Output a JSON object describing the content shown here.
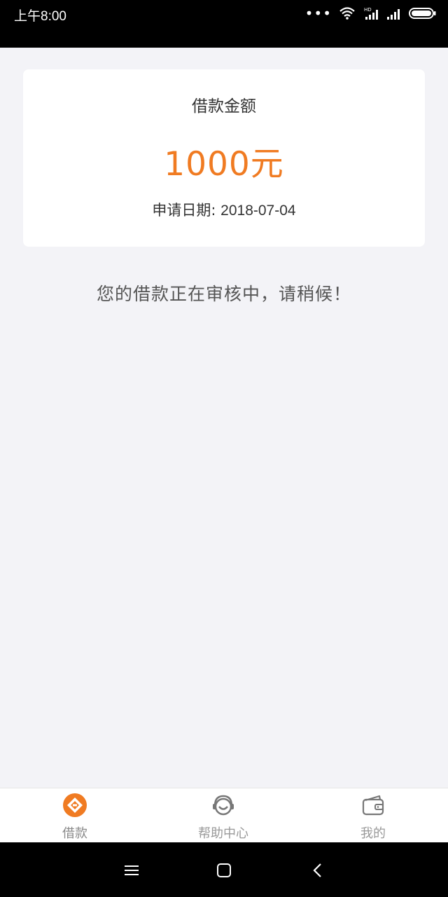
{
  "status_bar": {
    "time": "上午8:00",
    "icons": [
      "more-dots-icon",
      "wifi-icon",
      "hd-signal-icon",
      "signal-icon",
      "battery-icon"
    ]
  },
  "loan_card": {
    "title": "借款金额",
    "amount": "1000元",
    "date_label": "申请日期:",
    "date_value": "2018-07-04"
  },
  "message": "您的借款正在审核中，请稍候！",
  "tabs": [
    {
      "label": "借款",
      "icon": "loan-diamond-icon",
      "active": true
    },
    {
      "label": "帮助中心",
      "icon": "headset-icon",
      "active": false
    },
    {
      "label": "我的",
      "icon": "wallet-icon",
      "active": false
    }
  ],
  "nav_bar": {
    "buttons": [
      "menu-icon",
      "home-icon",
      "back-icon"
    ]
  },
  "colors": {
    "accent": "#f07b22",
    "background": "#f3f3f7",
    "text": "#333333"
  }
}
